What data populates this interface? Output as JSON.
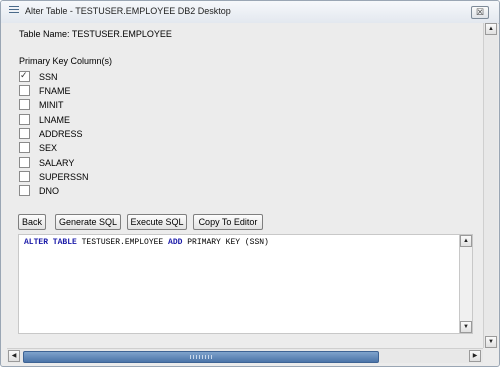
{
  "window": {
    "title": "Alter Table - TESTUSER.EMPLOYEE DB2 Desktop",
    "close_label": "☒"
  },
  "table_name_label": "Table Name: TESTUSER.EMPLOYEE",
  "pk_section_label": "Primary Key Column(s)",
  "columns": [
    {
      "name": "SSN",
      "checked": true
    },
    {
      "name": "FNAME",
      "checked": false
    },
    {
      "name": "MINIT",
      "checked": false
    },
    {
      "name": "LNAME",
      "checked": false
    },
    {
      "name": "ADDRESS",
      "checked": false
    },
    {
      "name": "SEX",
      "checked": false
    },
    {
      "name": "SALARY",
      "checked": false
    },
    {
      "name": "SUPERSSN",
      "checked": false
    },
    {
      "name": "DNO",
      "checked": false
    }
  ],
  "buttons": {
    "back": "Back",
    "generate": "Generate SQL",
    "execute": "Execute SQL",
    "copy": "Copy To Editor"
  },
  "sql": {
    "kw1": "ALTER TABLE",
    "part1": " TESTUSER.EMPLOYEE ",
    "kw2": "ADD",
    "part2": " PRIMARY KEY (SSN)"
  },
  "scroll": {
    "up": "▲",
    "down": "▼",
    "left": "◀",
    "right": "▶"
  }
}
